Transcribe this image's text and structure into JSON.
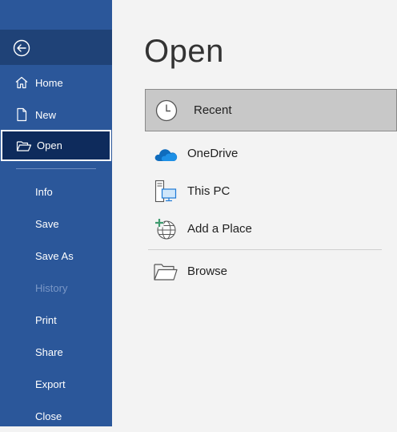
{
  "sidebar": {
    "back_icon": "back-arrow-icon",
    "items": [
      {
        "label": "Home",
        "icon": "home-icon"
      },
      {
        "label": "New",
        "icon": "new-document-icon"
      },
      {
        "label": "Open",
        "icon": "open-folder-icon"
      },
      {
        "label": "Info"
      },
      {
        "label": "Save"
      },
      {
        "label": "Save As"
      },
      {
        "label": "History"
      },
      {
        "label": "Print"
      },
      {
        "label": "Share"
      },
      {
        "label": "Export"
      },
      {
        "label": "Close"
      }
    ]
  },
  "main": {
    "title": "Open",
    "locations": [
      {
        "label": "Recent",
        "icon": "clock-icon"
      },
      {
        "label": "OneDrive",
        "icon": "cloud-icon"
      },
      {
        "label": "This PC",
        "icon": "computer-icon"
      },
      {
        "label": "Add a Place",
        "icon": "add-place-icon"
      },
      {
        "label": "Browse",
        "icon": "folder-icon"
      }
    ]
  },
  "colors": {
    "sidebar": "#2b579a",
    "sidebar_selected": "#0e2b5c",
    "disabled_text": "#7a97c6",
    "recent_highlight": "#c8c8c8"
  }
}
